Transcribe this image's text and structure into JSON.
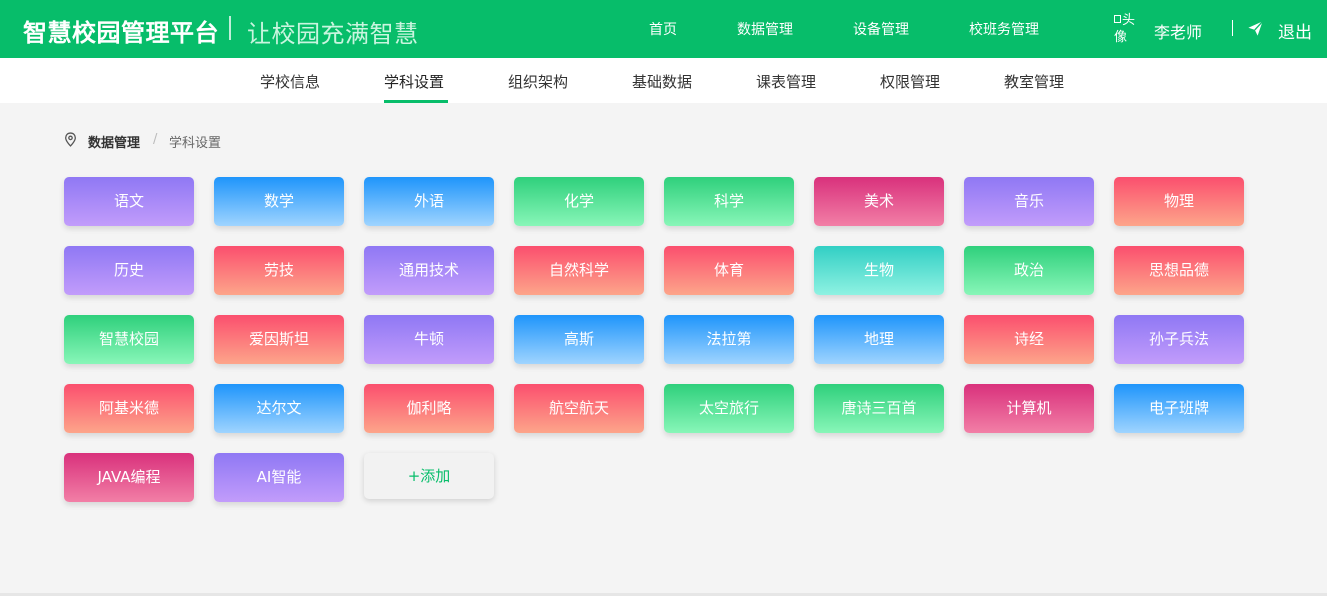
{
  "header": {
    "brand": "智慧校园管理平台",
    "slogan": "让校园充满智慧",
    "nav": [
      "首页",
      "数据管理",
      "设备管理",
      "校班务管理"
    ],
    "avatar_alt": "头像",
    "username": "李老师",
    "logout_label": "退出"
  },
  "subnav": {
    "tabs": [
      "学校信息",
      "学科设置",
      "组织架构",
      "基础数据",
      "课表管理",
      "权限管理",
      "教室管理"
    ],
    "active_index": 1
  },
  "breadcrumb": {
    "home": "数据管理",
    "separator": "/",
    "current": "学科设置"
  },
  "gradients": {
    "purple": [
      "#8f78f4",
      "#c29cfb"
    ],
    "blue": [
      "#1f95fb",
      "#9fd4ff"
    ],
    "green": [
      "#2fd07c",
      "#88f6b8"
    ],
    "magenta": [
      "#d9317c",
      "#f27fa6"
    ],
    "coral": [
      "#fb4f6e",
      "#fda58a"
    ],
    "teal": [
      "#32cfc4",
      "#8ff2e2"
    ]
  },
  "subjects": [
    {
      "name": "语文",
      "theme": "purple"
    },
    {
      "name": "数学",
      "theme": "blue"
    },
    {
      "name": "外语",
      "theme": "blue"
    },
    {
      "name": "化学",
      "theme": "green"
    },
    {
      "name": "科学",
      "theme": "green"
    },
    {
      "name": "美术",
      "theme": "magenta"
    },
    {
      "name": "音乐",
      "theme": "purple"
    },
    {
      "name": "物理",
      "theme": "coral"
    },
    {
      "name": "历史",
      "theme": "purple"
    },
    {
      "name": "劳技",
      "theme": "coral"
    },
    {
      "name": "通用技术",
      "theme": "purple"
    },
    {
      "name": "自然科学",
      "theme": "coral"
    },
    {
      "name": "体育",
      "theme": "coral"
    },
    {
      "name": "生物",
      "theme": "teal"
    },
    {
      "name": "政治",
      "theme": "green"
    },
    {
      "name": "思想品德",
      "theme": "coral"
    },
    {
      "name": "智慧校园",
      "theme": "green"
    },
    {
      "name": "爱因斯坦",
      "theme": "coral"
    },
    {
      "name": "牛顿",
      "theme": "purple"
    },
    {
      "name": "高斯",
      "theme": "blue"
    },
    {
      "name": "法拉第",
      "theme": "blue"
    },
    {
      "name": "地理",
      "theme": "blue"
    },
    {
      "name": "诗经",
      "theme": "coral"
    },
    {
      "name": "孙子兵法",
      "theme": "purple"
    },
    {
      "name": "阿基米德",
      "theme": "coral"
    },
    {
      "name": "达尔文",
      "theme": "blue"
    },
    {
      "name": "伽利略",
      "theme": "coral"
    },
    {
      "name": "航空航天",
      "theme": "coral"
    },
    {
      "name": "太空旅行",
      "theme": "green"
    },
    {
      "name": "唐诗三百首",
      "theme": "green"
    },
    {
      "name": "计算机",
      "theme": "magenta"
    },
    {
      "name": "电子班牌",
      "theme": "blue"
    },
    {
      "name": "JAVA编程",
      "theme": "magenta"
    },
    {
      "name": "AI智能",
      "theme": "purple"
    }
  ],
  "add_label": "+添加"
}
